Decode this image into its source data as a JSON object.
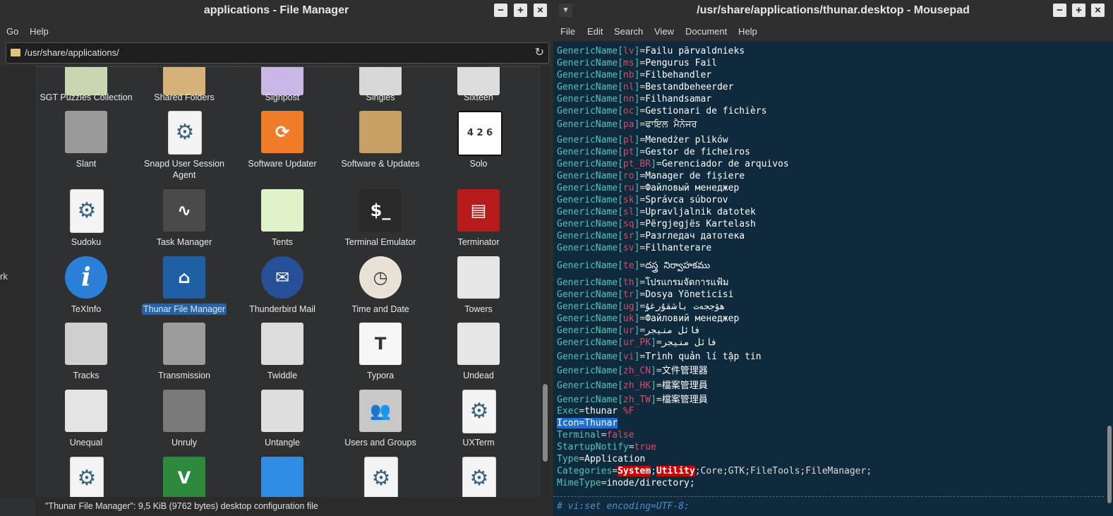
{
  "file_manager": {
    "title": "applications - File Manager",
    "menus": [
      "Go",
      "Help"
    ],
    "path": "/usr/share/applications/",
    "side_fragment": "rk",
    "status": "\"Thunar File Manager\": 9,5 KiB (9762 bytes) desktop configuration file",
    "apps": [
      {
        "name": "SGT Puzzles Collection",
        "icon": "puzzle-flag-icon"
      },
      {
        "name": "Shared Folders",
        "icon": "shared-folder-icon"
      },
      {
        "name": "Signpost",
        "icon": "signpost-icon"
      },
      {
        "name": "Singles",
        "icon": "singles-icon"
      },
      {
        "name": "Sixteen",
        "icon": "sixteen-icon"
      },
      {
        "name": "Slant",
        "icon": "slant-icon"
      },
      {
        "name": "Snapd User Session Agent",
        "icon": "gear-icon"
      },
      {
        "name": "Software Updater",
        "icon": "updater-icon"
      },
      {
        "name": "Software & Updates",
        "icon": "software-box-icon"
      },
      {
        "name": "Solo",
        "icon": "solo-icon"
      },
      {
        "name": "Sudoku",
        "icon": "gear-icon"
      },
      {
        "name": "Task Manager",
        "icon": "task-manager-icon"
      },
      {
        "name": "Tents",
        "icon": "tents-icon"
      },
      {
        "name": "Terminal Emulator",
        "icon": "terminal-icon"
      },
      {
        "name": "Terminator",
        "icon": "terminator-icon"
      },
      {
        "name": "TeXInfo",
        "icon": "info-icon"
      },
      {
        "name": "Thunar File Manager",
        "icon": "home-folder-icon"
      },
      {
        "name": "Thunderbird Mail",
        "icon": "thunderbird-icon"
      },
      {
        "name": "Time and Date",
        "icon": "clock-calendar-icon"
      },
      {
        "name": "Towers",
        "icon": "towers-icon"
      },
      {
        "name": "Tracks",
        "icon": "tracks-icon"
      },
      {
        "name": "Transmission",
        "icon": "transmission-icon"
      },
      {
        "name": "Twiddle",
        "icon": "twiddle-icon"
      },
      {
        "name": "Typora",
        "icon": "typora-icon"
      },
      {
        "name": "Undead",
        "icon": "undead-icon"
      },
      {
        "name": "Unequal",
        "icon": "unequal-icon"
      },
      {
        "name": "Unruly",
        "icon": "unruly-icon"
      },
      {
        "name": "Untangle",
        "icon": "untangle-icon"
      },
      {
        "name": "Users and Groups",
        "icon": "users-icon"
      },
      {
        "name": "UXTerm",
        "icon": "gear-icon"
      },
      {
        "name": "",
        "icon": "gear-icon"
      },
      {
        "name": "",
        "icon": "vim-icon"
      },
      {
        "name": "",
        "icon": "blue-app-icon"
      },
      {
        "name": "",
        "icon": "gear-icon"
      },
      {
        "name": "",
        "icon": "gear-icon"
      }
    ],
    "selected_app": "Thunar File Manager"
  },
  "mousepad": {
    "title": "/usr/share/applications/thunar.desktop - Mousepad",
    "menus": [
      "File",
      "Edit",
      "Search",
      "View",
      "Document",
      "Help"
    ],
    "generic_names": [
      {
        "key": "GenericName",
        "lang": "lv",
        "value": "Failu pārvaldnieks"
      },
      {
        "key": "GenericName",
        "lang": "ms",
        "value": "Pengurus Fail"
      },
      {
        "key": "GenericName",
        "lang": "nb",
        "value": "Filbehandler"
      },
      {
        "key": "GenericName",
        "lang": "nl",
        "value": "Bestandbeheerder"
      },
      {
        "key": "GenericName",
        "lang": "nn",
        "value": "Filhandsamar"
      },
      {
        "key": "GenericName",
        "lang": "oc",
        "value": "Gestionari de fichièrs"
      },
      {
        "key": "GenericName",
        "lang": "pa",
        "value": "ਫਾਇਲ ਮੈਨੇਜਰ"
      },
      {
        "key": "GenericName",
        "lang": "pl",
        "value": "Menedżer plików"
      },
      {
        "key": "GenericName",
        "lang": "pt",
        "value": "Gestor de ficheiros"
      },
      {
        "key": "GenericName",
        "lang": "pt_BR",
        "value": "Gerenciador de arquivos"
      },
      {
        "key": "GenericName",
        "lang": "ro",
        "value": "Manager de fișiere"
      },
      {
        "key": "GenericName",
        "lang": "ru",
        "value": "Файловый менеджер"
      },
      {
        "key": "GenericName",
        "lang": "sk",
        "value": "Správca súborov"
      },
      {
        "key": "GenericName",
        "lang": "sl",
        "value": "Upravljalnik datotek"
      },
      {
        "key": "GenericName",
        "lang": "sq",
        "value": "Përgjegjës Kartelash"
      },
      {
        "key": "GenericName",
        "lang": "sr",
        "value": "Разгледач датотека"
      },
      {
        "key": "GenericName",
        "lang": "sv",
        "value": "Filhanterare"
      },
      {
        "key": "GenericName",
        "lang": "te",
        "value": "దస్త్ర నిర్వాహకము"
      },
      {
        "key": "GenericName",
        "lang": "th",
        "value": "โปรแกรมจัดการแฟ้ม"
      },
      {
        "key": "GenericName",
        "lang": "tr",
        "value": "Dosya Yöneticisi"
      },
      {
        "key": "GenericName",
        "lang": "ug",
        "value": "ھۆججەت باشقۇرغۇ"
      },
      {
        "key": "GenericName",
        "lang": "uk",
        "value": "Файловий менеджер"
      },
      {
        "key": "GenericName",
        "lang": "ur",
        "value": "فائل منیجر"
      },
      {
        "key": "GenericName",
        "lang": "ur_PK",
        "value": "فائل منیجر"
      },
      {
        "key": "GenericName",
        "lang": "vi",
        "value": "Trình quản lí tập tin"
      },
      {
        "key": "GenericName",
        "lang": "zh_CN",
        "value": "文件管理器"
      },
      {
        "key": "GenericName",
        "lang": "zh_HK",
        "value": "檔案管理員"
      },
      {
        "key": "GenericName",
        "lang": "zh_TW",
        "value": "檔案管理員"
      }
    ],
    "exec": {
      "key": "Exec",
      "value": "thunar",
      "arg": "%F"
    },
    "icon_line": "Icon=Thunar",
    "terminal": {
      "key": "Terminal",
      "value": "false"
    },
    "startup": {
      "key": "StartupNotify",
      "value": "true"
    },
    "type": {
      "key": "Type",
      "value": "Application"
    },
    "categories": {
      "key": "Categories",
      "cat1": "System",
      "cat2": "Utility",
      "rest": "Core;GTK;FileTools;FileManager;"
    },
    "mimetype": {
      "key": "MimeType",
      "value": "inode/directory;"
    },
    "comment": "# vi:set encoding=UTF-8:"
  }
}
